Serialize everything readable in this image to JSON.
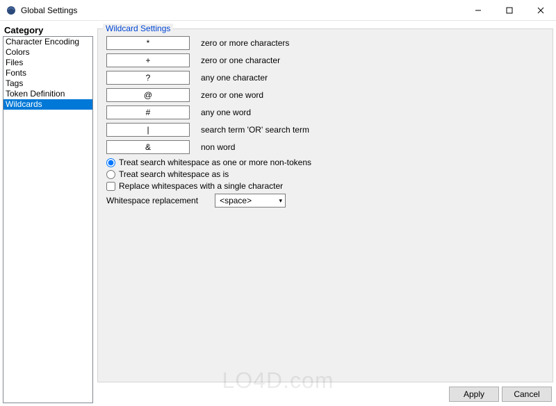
{
  "window": {
    "title": "Global Settings"
  },
  "sidebar": {
    "header": "Category",
    "items": [
      {
        "label": "Character Encoding",
        "selected": false
      },
      {
        "label": "Colors",
        "selected": false
      },
      {
        "label": "Files",
        "selected": false
      },
      {
        "label": "Fonts",
        "selected": false
      },
      {
        "label": "Tags",
        "selected": false
      },
      {
        "label": "Token Definition",
        "selected": false
      },
      {
        "label": "Wildcards",
        "selected": true
      }
    ]
  },
  "panel": {
    "title": "Wildcard Settings",
    "wildcards": [
      {
        "char": "*",
        "desc": "zero or more characters"
      },
      {
        "char": "+",
        "desc": "zero or one character"
      },
      {
        "char": "?",
        "desc": "any one character"
      },
      {
        "char": "@",
        "desc": "zero or one word"
      },
      {
        "char": "#",
        "desc": "any one word"
      },
      {
        "char": "|",
        "desc": "search term 'OR' search term"
      },
      {
        "char": "&",
        "desc": "non word"
      }
    ],
    "radio1": "Treat search whitespace as one or more non-tokens",
    "radio2": "Treat search whitespace as is",
    "checkbox": "Replace whitespaces with a single character",
    "replacement_label": "Whitespace replacement",
    "replacement_value": "<space>",
    "radio_selected": 0,
    "checkbox_checked": false
  },
  "buttons": {
    "apply": "Apply",
    "cancel": "Cancel"
  },
  "watermark": "LO4D.com"
}
